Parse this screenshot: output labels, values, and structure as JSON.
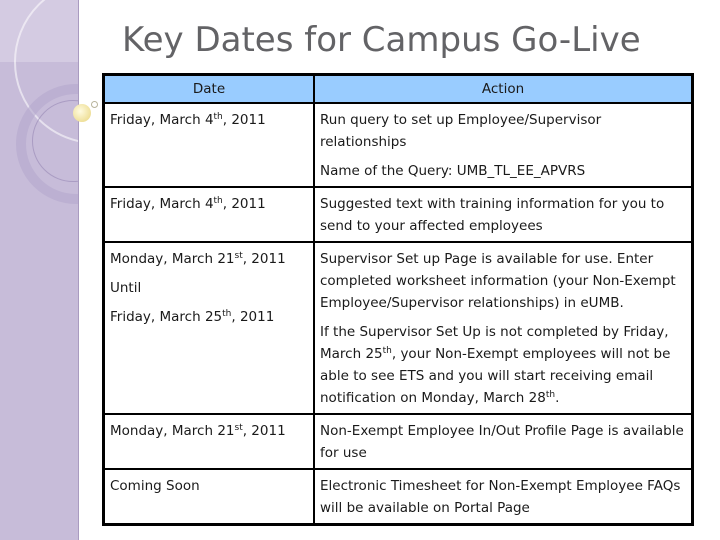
{
  "slide": {
    "title": "Key Dates for Campus Go-Live"
  },
  "table": {
    "headers": {
      "date": "Date",
      "action": "Action"
    },
    "rows": [
      {
        "date": [
          {
            "pre": "Friday, March 4",
            "sup": "th",
            "post": ", 2011"
          }
        ],
        "action": [
          "Run query to set up Employee/Supervisor relationships",
          "Name of the Query:  UMB_TL_EE_APVRS"
        ]
      },
      {
        "date": [
          {
            "pre": "Friday, March 4",
            "sup": "th",
            "post": ", 2011"
          }
        ],
        "action": [
          "Suggested text with training information for you to send to your affected employees"
        ]
      },
      {
        "date": [
          {
            "pre": "Monday, March 21",
            "sup": "st",
            "post": ", 2011"
          },
          {
            "pre": "Until",
            "sup": "",
            "post": ""
          },
          {
            "pre": "Friday, March 25",
            "sup": "th",
            "post": ", 2011"
          }
        ],
        "action": [
          "Supervisor Set up Page is available for use.  Enter completed worksheet information (your Non-Exempt Employee/Supervisor relationships) in eUMB.",
          {
            "pre": "If the Supervisor Set Up is not completed by Friday, March 25",
            "sup": "th",
            "mid": ", your Non-Exempt employees will not be able to see ETS and you will start receiving email notification on Monday, March 28",
            "sup2": "th",
            "post": "."
          }
        ]
      },
      {
        "date": [
          {
            "pre": "Monday, March 21",
            "sup": "st",
            "post": ", 2011"
          }
        ],
        "action": [
          "Non-Exempt Employee In/Out Profile Page is available for use"
        ]
      },
      {
        "date": [
          {
            "pre": "Coming Soon",
            "sup": "",
            "post": ""
          }
        ],
        "action": [
          "Electronic Timesheet for Non-Exempt Employee FAQs will be available on Portal Page"
        ]
      }
    ]
  },
  "colors": {
    "header_bg": "#99ccff",
    "side_band": "#c7bcd9",
    "title_text": "#636366"
  }
}
